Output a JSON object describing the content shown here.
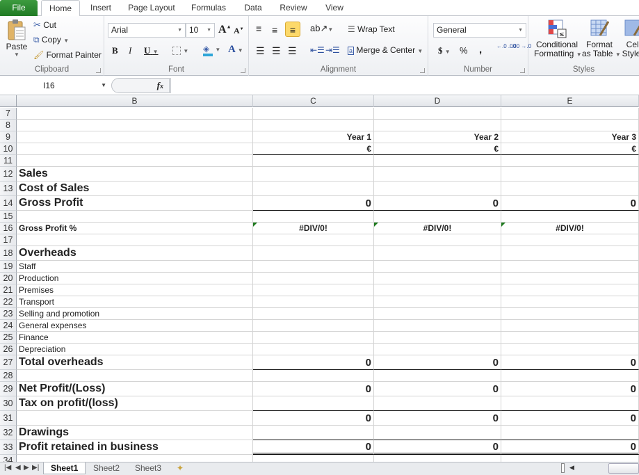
{
  "ribbon_tabs": [
    "File",
    "Home",
    "Insert",
    "Page Layout",
    "Formulas",
    "Data",
    "Review",
    "View"
  ],
  "active_tab": "Home",
  "clipboard": {
    "paste": "Paste",
    "cut": "Cut",
    "copy": "Copy",
    "format_painter": "Format Painter",
    "label": "Clipboard"
  },
  "font": {
    "name": "Arial",
    "size": "10",
    "label": "Font",
    "bold": "B",
    "italic": "I",
    "underline": "U",
    "grow": "A",
    "shrink": "A",
    "color": "A"
  },
  "alignment": {
    "wrap_text": "Wrap Text",
    "merge_center": "Merge & Center",
    "label": "Alignment"
  },
  "number": {
    "format": "General",
    "currency": "$",
    "percent": "%",
    "comma": ",",
    "inc_decimal": "←.0 .00",
    "dec_decimal": ".00 →.0",
    "label": "Number"
  },
  "styles": {
    "conditional_1": "Conditional",
    "conditional_2": "Formatting",
    "format_table_1": "Format",
    "format_table_2": "as Table",
    "cell_styles_1": "Cell",
    "cell_styles_2": "Styles",
    "label": "Styles"
  },
  "formula_bar": {
    "name_box": "I16",
    "fx": "fx",
    "formula": ""
  },
  "columns": [
    "B",
    "C",
    "D",
    "E"
  ],
  "rows": [
    {
      "n": "7",
      "b": "",
      "c": "",
      "d": "",
      "e": ""
    },
    {
      "n": "8",
      "b": "",
      "c": "",
      "d": "",
      "e": ""
    },
    {
      "n": "9",
      "b": "",
      "c": "Year 1",
      "d": "Year 2",
      "e": "Year 3"
    },
    {
      "n": "10",
      "b": "",
      "c": "€",
      "d": "€",
      "e": "€"
    },
    {
      "n": "11",
      "b": "",
      "c": "",
      "d": "",
      "e": ""
    },
    {
      "n": "12",
      "b": "Sales",
      "c": "",
      "d": "",
      "e": ""
    },
    {
      "n": "13",
      "b": "Cost of Sales",
      "c": "",
      "d": "",
      "e": ""
    },
    {
      "n": "14",
      "b": "Gross Profit",
      "c": "0",
      "d": "0",
      "e": "0"
    },
    {
      "n": "15",
      "b": "",
      "c": "",
      "d": "",
      "e": ""
    },
    {
      "n": "16",
      "b": "Gross Profit %",
      "c": "#DIV/0!",
      "d": "#DIV/0!",
      "e": "#DIV/0!"
    },
    {
      "n": "17",
      "b": "",
      "c": "",
      "d": "",
      "e": ""
    },
    {
      "n": "18",
      "b": "Overheads",
      "c": "",
      "d": "",
      "e": ""
    },
    {
      "n": "19",
      "b": "Staff",
      "c": "",
      "d": "",
      "e": ""
    },
    {
      "n": "20",
      "b": "Production",
      "c": "",
      "d": "",
      "e": ""
    },
    {
      "n": "21",
      "b": "Premises",
      "c": "",
      "d": "",
      "e": ""
    },
    {
      "n": "22",
      "b": "Transport",
      "c": "",
      "d": "",
      "e": ""
    },
    {
      "n": "23",
      "b": "Selling and promotion",
      "c": "",
      "d": "",
      "e": ""
    },
    {
      "n": "24",
      "b": "General expenses",
      "c": "",
      "d": "",
      "e": ""
    },
    {
      "n": "25",
      "b": "Finance",
      "c": "",
      "d": "",
      "e": ""
    },
    {
      "n": "26",
      "b": "Depreciation",
      "c": "",
      "d": "",
      "e": ""
    },
    {
      "n": "27",
      "b": "Total overheads",
      "c": "0",
      "d": "0",
      "e": "0"
    },
    {
      "n": "28",
      "b": "",
      "c": "",
      "d": "",
      "e": ""
    },
    {
      "n": "29",
      "b": "Net Profit/(Loss)",
      "c": "0",
      "d": "0",
      "e": "0"
    },
    {
      "n": "30",
      "b": "Tax on profit/(loss)",
      "c": "",
      "d": "",
      "e": ""
    },
    {
      "n": "31",
      "b": "",
      "c": "0",
      "d": "0",
      "e": "0"
    },
    {
      "n": "32",
      "b": "Drawings",
      "c": "",
      "d": "",
      "e": ""
    },
    {
      "n": "33",
      "b": "Profit retained in business",
      "c": "0",
      "d": "0",
      "e": "0"
    },
    {
      "n": "34",
      "b": "",
      "c": "",
      "d": "",
      "e": ""
    }
  ],
  "sheets": [
    "Sheet1",
    "Sheet2",
    "Sheet3"
  ],
  "active_sheet": "Sheet1",
  "colors": {
    "file_tab": "#2a8a2f",
    "error_indicator": "#1e7a1e",
    "highlight": "#fcd96a"
  }
}
